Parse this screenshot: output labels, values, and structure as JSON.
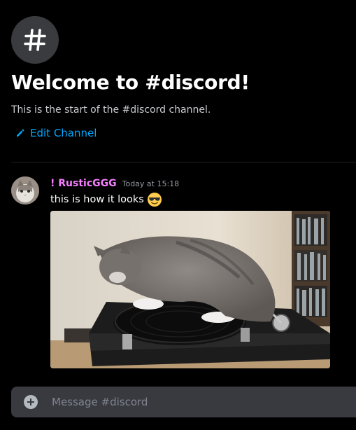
{
  "welcome": {
    "title": "Welcome to #discord!",
    "subtitle": "This is the start of the #discord channel.",
    "edit_label": "Edit Channel",
    "channel_icon": "hash-icon",
    "edit_icon": "pencil-icon"
  },
  "message": {
    "username": "! RusticGGG",
    "timestamp": "Today at 15:18",
    "text": "this is how it looks",
    "emoji": "sunglasses-emoji",
    "attachment": "cat-on-turntable-gif"
  },
  "composer": {
    "placeholder": "Message #discord",
    "add_icon": "plus-circle-icon"
  },
  "colors": {
    "background": "#000000",
    "link": "#00a8fc",
    "username": "#f47fff",
    "composer_bg": "#383a40"
  }
}
